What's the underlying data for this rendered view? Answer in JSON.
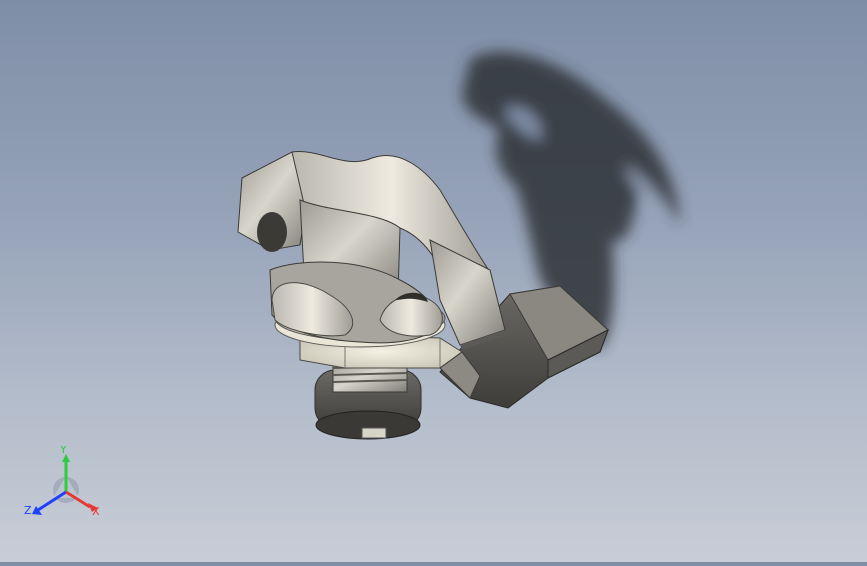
{
  "viewport": {
    "background_top": "#7f8ea7",
    "background_bottom": "#c8cdd6",
    "model_description_icon": "cam-lock-part-model"
  },
  "triad": {
    "x_label": "X",
    "y_label": "Y",
    "z_label": "Z",
    "x_color": "#e53935",
    "y_color": "#2ecc40",
    "z_color": "#1e40ff"
  }
}
